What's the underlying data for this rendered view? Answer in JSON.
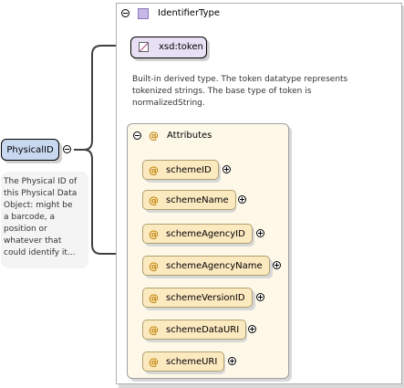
{
  "element": {
    "name": "PhysicalID",
    "documentation_lines": [
      "The Physical ID of",
      "this Physical Data",
      "Object: might be",
      "a barcode, a",
      "position or",
      "whatever that",
      "could identify it..."
    ]
  },
  "type": {
    "name": "IdentifierType",
    "base_type": "xsd:token",
    "documentation_lines": [
      "Built-in derived type. The token datatype represents",
      "tokenized strings. The base type of token is",
      "normalizedString."
    ]
  },
  "attributes_group": {
    "label": "Attributes",
    "items": [
      {
        "name": "schemeID"
      },
      {
        "name": "schemeName"
      },
      {
        "name": "schemeAgencyID"
      },
      {
        "name": "schemeAgencyName"
      },
      {
        "name": "schemeVersionID"
      },
      {
        "name": "schemeDataURI"
      },
      {
        "name": "schemeURI"
      }
    ]
  },
  "icons": {
    "attribute_marker": "@",
    "collapse": "minus-circle-icon",
    "expand": "plus-circle-icon",
    "complex_type": "complex-type-icon",
    "simple_type": "simple-type-icon"
  },
  "colors": {
    "element_fill": "#c8d8f0",
    "simple_type_fill": "#e8e0f4",
    "attribute_fill": "#fbe9c0",
    "attribute_marker": "#c08000"
  }
}
